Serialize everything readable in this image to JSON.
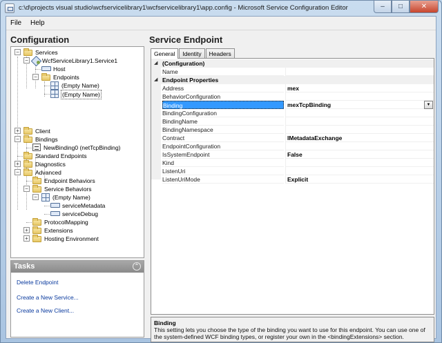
{
  "window": {
    "title": "c:\\d\\projects visual studio\\wcfservicelibrary1\\wcfservicelibrary1\\app.config - Microsoft Service Configuration Editor",
    "minimize": "–",
    "maximize": "□",
    "close": "✕"
  },
  "menu": {
    "file_label": "File",
    "help_label": "Help"
  },
  "configuration": {
    "header": "Configuration",
    "tree": {
      "services": "Services",
      "service1": "WcfServiceLibrary1.Service1",
      "host": "Host",
      "endpoints": "Endpoints",
      "endpoint_a": "(Empty Name)",
      "endpoint_b": "(Empty Name)",
      "client": "Client",
      "bindings": "Bindings",
      "new_binding": "NewBinding0 (netTcpBinding)",
      "standard_endpoints": "Standard Endpoints",
      "diagnostics": "Diagnostics",
      "advanced": "Advanced",
      "endpoint_behaviors": "Endpoint Behaviors",
      "service_behaviors": "Service Behaviors",
      "behavior_empty": "(Empty Name)",
      "service_metadata": "serviceMetadata",
      "service_debug": "serviceDebug",
      "protocol_mapping": "ProtocolMapping",
      "extensions": "Extensions",
      "hosting_environment": "Hosting Environment"
    }
  },
  "tasks": {
    "header": "Tasks",
    "collapse_glyph": "⌃",
    "delete_endpoint": "Delete Endpoint",
    "create_service": "Create a New Service...",
    "create_client": "Create a New Client..."
  },
  "service_endpoint": {
    "header": "Service Endpoint",
    "tabs": [
      "General",
      "Identity",
      "Headers"
    ],
    "categories": {
      "configuration": "(Configuration)",
      "endpoint_properties": "Endpoint Properties"
    },
    "collapse_glyph": "◢",
    "properties": {
      "name": {
        "label": "Name",
        "value": ""
      },
      "address": {
        "label": "Address",
        "value": "mex"
      },
      "behavior_configuration": {
        "label": "BehaviorConfiguration",
        "value": ""
      },
      "binding": {
        "label": "Binding",
        "value": "mexTcpBinding"
      },
      "binding_configuration": {
        "label": "BindingConfiguration",
        "value": ""
      },
      "binding_name": {
        "label": "BindingName",
        "value": ""
      },
      "binding_namespace": {
        "label": "BindingNamespace",
        "value": ""
      },
      "contract": {
        "label": "Contract",
        "value": "IMetadataExchange"
      },
      "endpoint_configuration": {
        "label": "EndpointConfiguration",
        "value": ""
      },
      "is_system_endpoint": {
        "label": "IsSystemEndpoint",
        "value": "False"
      },
      "kind": {
        "label": "Kind",
        "value": ""
      },
      "listen_uri": {
        "label": "ListenUri",
        "value": ""
      },
      "listen_uri_mode": {
        "label": "ListenUriMode",
        "value": "Explicit"
      }
    },
    "dropdown_glyph": "▼",
    "help": {
      "title": "Binding",
      "text": "This setting lets you choose the type of the binding you want to use for this endpoint. You can use one of the system-defined WCF binding types, or register your own in the <bindingExtensions> section."
    }
  }
}
